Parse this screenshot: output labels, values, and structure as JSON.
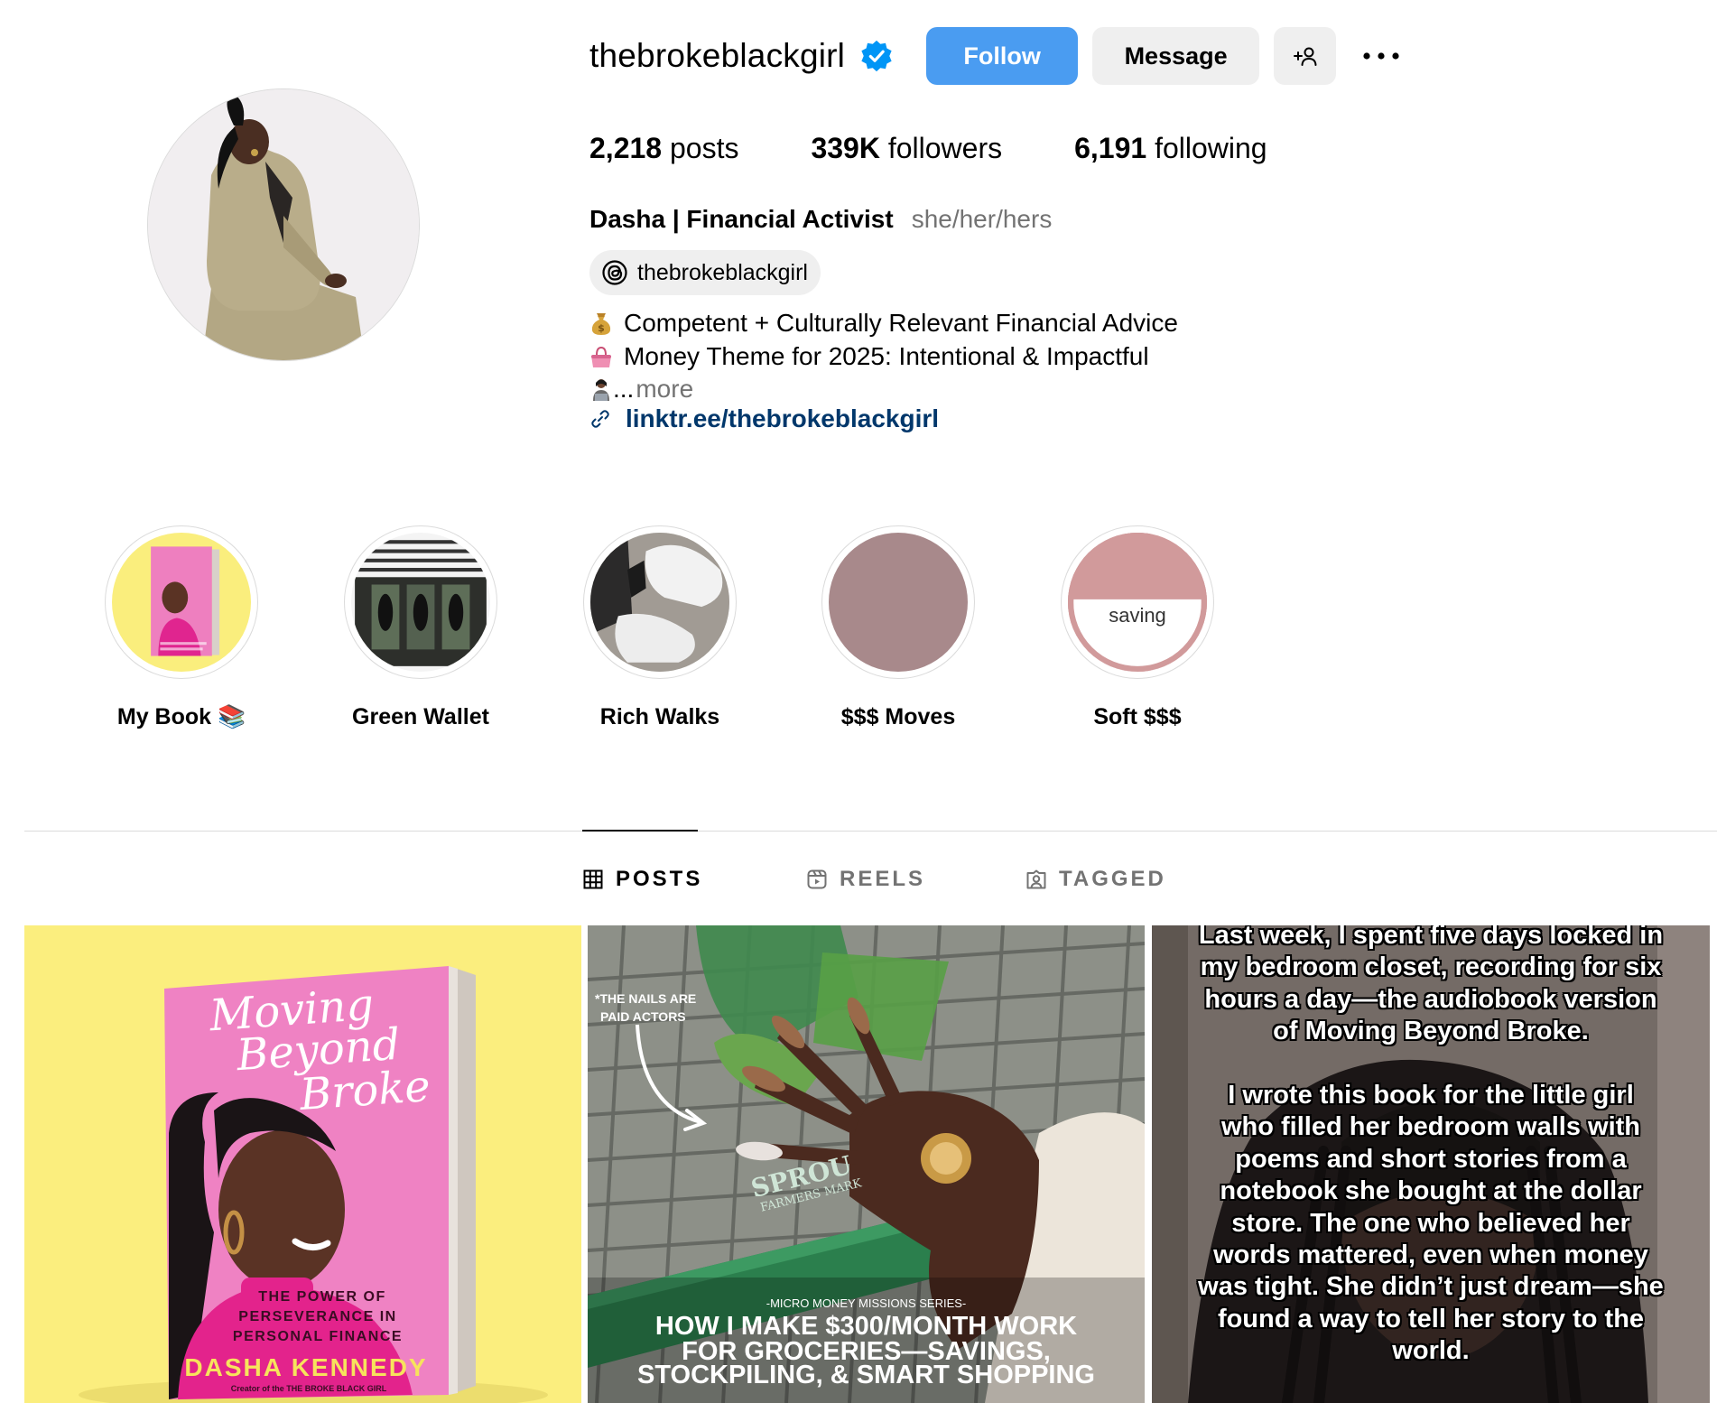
{
  "profile": {
    "username": "thebrokeblackgirl",
    "verified": true,
    "buttons": {
      "follow": "Follow",
      "message": "Message"
    },
    "stats": {
      "posts_value": "2,218",
      "posts_label": "posts",
      "followers_value": "339K",
      "followers_label": "followers",
      "following_value": "6,191",
      "following_label": "following"
    },
    "full_name": "Dasha | Financial Activist",
    "pronouns": "she/her/hers",
    "threads_handle": "thebrokeblackgirl",
    "bio": {
      "line1": "Competent + Culturally Relevant Financial Advice",
      "line2": "Money Theme for 2025: Intentional & Impactful",
      "line3_ellipsis": "...",
      "more": "more"
    },
    "link": "linktr.ee/thebrokeblackgirl"
  },
  "highlights": [
    {
      "label": "My Book 📚"
    },
    {
      "label": "Green Wallet"
    },
    {
      "label": "Rich Walks"
    },
    {
      "label": "$$$ Moves"
    },
    {
      "label": "Soft $$$",
      "cover_text": "saving"
    }
  ],
  "tabs": {
    "posts": "POSTS",
    "reels": "REELS",
    "tagged": "TAGGED",
    "active": "posts"
  },
  "posts": [
    {
      "type": "pinned",
      "book_title_1": "Moving",
      "book_title_2": "Beyond",
      "book_title_3": "Broke",
      "book_subtitle_1": "THE POWER OF",
      "book_subtitle_2": "PERSEVERANCE IN",
      "book_subtitle_3": "PERSONAL FINANCE",
      "book_author": "DASHA KENNEDY",
      "book_credit": "Creator of the THE BROKE BLACK GIRL"
    },
    {
      "type": "carousel",
      "note_1": "*THE NAILS ARE",
      "note_2": "PAID ACTORS",
      "series": "-MICRO MONEY MISSIONS SERIES-",
      "headline_1": "HOW I MAKE $300/MONTH WORK",
      "headline_2": "FOR GROCERIES—SAVINGS,",
      "headline_3": "STOCKPILING, & SMART SHOPPING",
      "cart_brand": "SPROU",
      "cart_sub": "FARMERS MARK"
    },
    {
      "type": "reel",
      "caption_lines": [
        "Last week, I spent five days locked in",
        "my bedroom closet, recording for six",
        "hours a day—the audiobook version",
        "of Moving Beyond Broke.",
        "",
        "I wrote this book for the little girl",
        "who filled her bedroom walls with",
        "poems and short stories from a",
        "notebook she bought at the dollar",
        "store. The one who believed her",
        "words mattered, even when money",
        "was tight. She didn’t just dream—she",
        "found a way to tell her story to the",
        "world."
      ]
    }
  ],
  "colors": {
    "follow_blue": "#4a9cf1",
    "verified_blue": "#0095f6",
    "link_blue": "#00376b",
    "muted": "#737373",
    "button_grey": "#efefef",
    "post1_bg": "#fbee7e",
    "book_pink": "#ee7fbf"
  }
}
